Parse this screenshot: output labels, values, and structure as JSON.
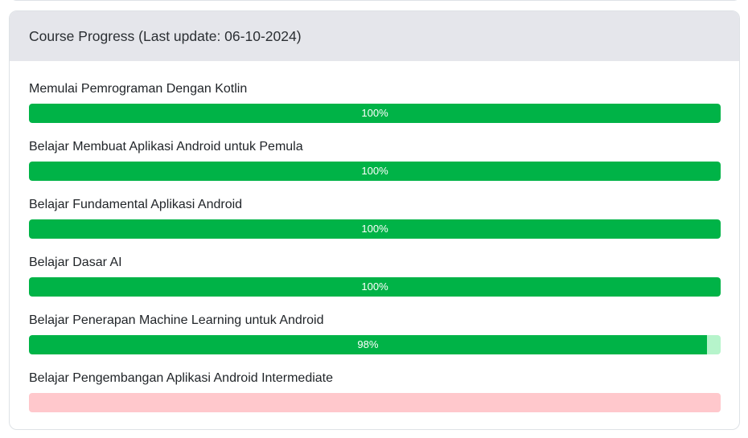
{
  "header": {
    "title": "Course Progress (Last update: 06-10-2024)"
  },
  "colors": {
    "complete": "#00b347",
    "partial_remaining": "#b6f4cb",
    "not_started": "#ffc8cc"
  },
  "courses": [
    {
      "title": "Memulai Pemrograman Dengan Kotlin",
      "progress": 100,
      "label": "100%"
    },
    {
      "title": "Belajar Membuat Aplikasi Android untuk Pemula",
      "progress": 100,
      "label": "100%"
    },
    {
      "title": "Belajar Fundamental Aplikasi Android",
      "progress": 100,
      "label": "100%"
    },
    {
      "title": "Belajar Dasar AI",
      "progress": 100,
      "label": "100%"
    },
    {
      "title": "Belajar Penerapan Machine Learning untuk Android",
      "progress": 98,
      "label": "98%"
    },
    {
      "title": "Belajar Pengembangan Aplikasi Android Intermediate",
      "progress": 0,
      "label": ""
    }
  ]
}
